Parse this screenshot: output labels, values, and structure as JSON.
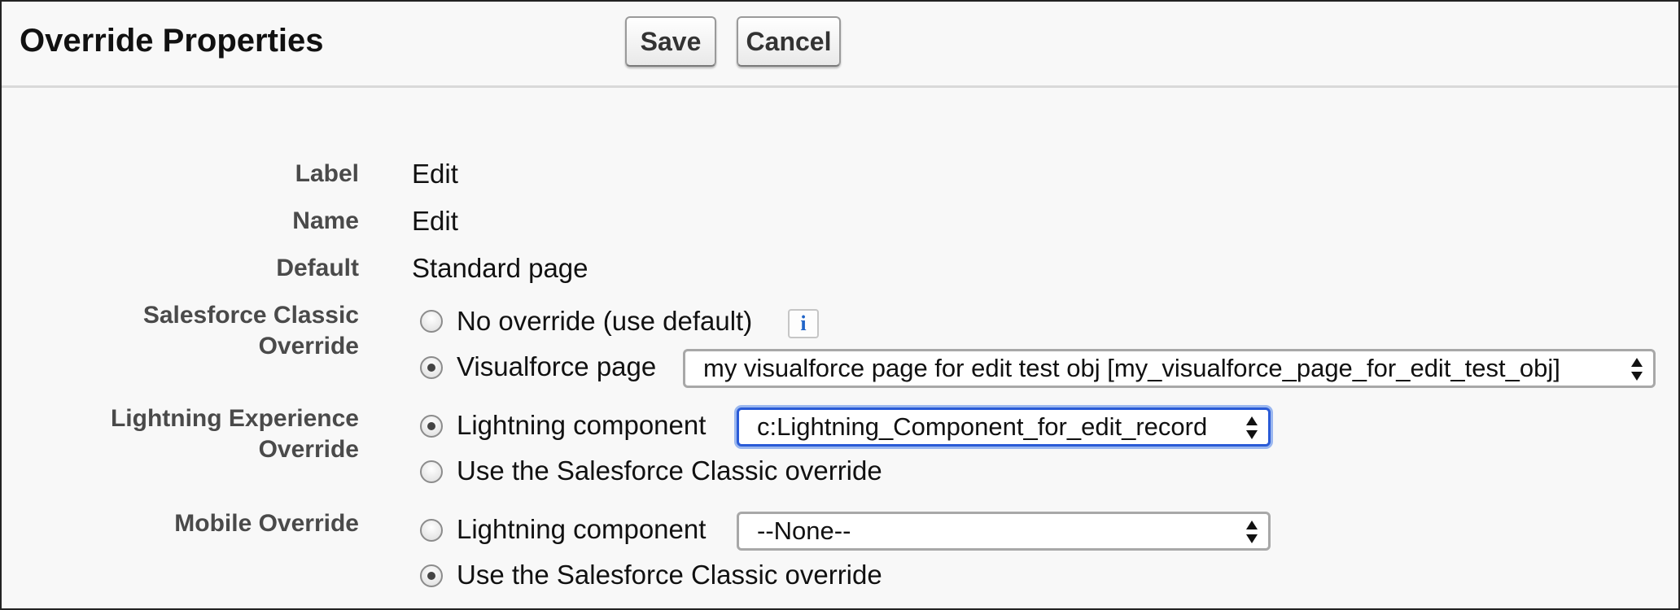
{
  "header": {
    "title": "Override Properties",
    "save_label": "Save",
    "cancel_label": "Cancel"
  },
  "fields": {
    "label": {
      "label": "Label",
      "value": "Edit"
    },
    "name": {
      "label": "Name",
      "value": "Edit"
    },
    "default": {
      "label": "Default",
      "value": "Standard page"
    }
  },
  "classic_override": {
    "label_line1": "Salesforce Classic",
    "label_line2": "Override",
    "options": [
      {
        "label": "No override (use default)",
        "checked": false
      },
      {
        "label": "Visualforce page",
        "checked": true
      }
    ],
    "select_value": "my visualforce page for edit test obj [my_visualforce_page_for_edit_test_obj]"
  },
  "lightning_override": {
    "label_line1": "Lightning Experience",
    "label_line2": "Override",
    "options": [
      {
        "label": "Lightning component",
        "checked": true
      },
      {
        "label": "Use the Salesforce Classic override",
        "checked": false
      }
    ],
    "select_value": "c:Lightning_Component_for_edit_record"
  },
  "mobile_override": {
    "label": "Mobile Override",
    "options": [
      {
        "label": "Lightning component",
        "checked": false
      },
      {
        "label": "Use the Salesforce Classic override",
        "checked": true
      }
    ],
    "select_value": "--None--"
  },
  "colors": {
    "focus_ring": "#2a5bd7",
    "info_icon": "#1f64c8",
    "label_text": "#4a4a4a"
  }
}
